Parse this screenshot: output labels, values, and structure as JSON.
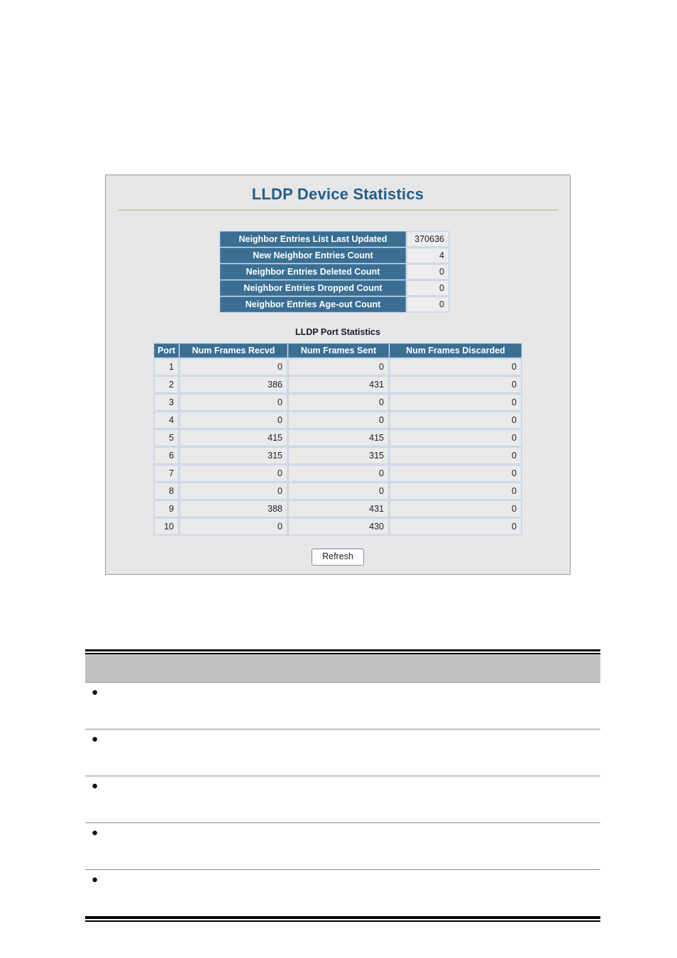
{
  "panel": {
    "title": "LLDP Device Statistics",
    "summary": {
      "rows": [
        {
          "label": "Neighbor Entries List Last Updated",
          "value": "370636"
        },
        {
          "label": "New Neighbor Entries Count",
          "value": "4"
        },
        {
          "label": "Neighbor Entries Deleted Count",
          "value": "0"
        },
        {
          "label": "Neighbor Entries Dropped Count",
          "value": "0"
        },
        {
          "label": "Neighbor Entries Age-out Count",
          "value": "0"
        }
      ]
    },
    "port_stats": {
      "caption": "LLDP Port Statistics",
      "columns": [
        "Port",
        "Num Frames Recvd",
        "Num Frames Sent",
        "Num Frames Discarded"
      ],
      "rows": [
        {
          "port": "1",
          "recvd": "0",
          "sent": "0",
          "discarded": "0"
        },
        {
          "port": "2",
          "recvd": "386",
          "sent": "431",
          "discarded": "0"
        },
        {
          "port": "3",
          "recvd": "0",
          "sent": "0",
          "discarded": "0"
        },
        {
          "port": "4",
          "recvd": "0",
          "sent": "0",
          "discarded": "0"
        },
        {
          "port": "5",
          "recvd": "415",
          "sent": "415",
          "discarded": "0"
        },
        {
          "port": "6",
          "recvd": "315",
          "sent": "315",
          "discarded": "0"
        },
        {
          "port": "7",
          "recvd": "0",
          "sent": "0",
          "discarded": "0"
        },
        {
          "port": "8",
          "recvd": "0",
          "sent": "0",
          "discarded": "0"
        },
        {
          "port": "9",
          "recvd": "388",
          "sent": "431",
          "discarded": "0"
        },
        {
          "port": "10",
          "recvd": "0",
          "sent": "430",
          "discarded": "0"
        }
      ]
    },
    "refresh_label": "Refresh"
  },
  "description_table": {
    "header": "",
    "bullet_glyph": "●",
    "rows": [
      {
        "text": ""
      },
      {
        "text": ""
      },
      {
        "text": ""
      },
      {
        "text": ""
      },
      {
        "text": ""
      }
    ]
  },
  "colors": {
    "title_blue": "#235e8c",
    "header_steel": "#3a6e93",
    "panel_bg": "#e7e7e7",
    "cell_bg": "#eaeaea",
    "cell_border": "#c9d4e3",
    "desc_header_gray": "#c2c2c2"
  }
}
